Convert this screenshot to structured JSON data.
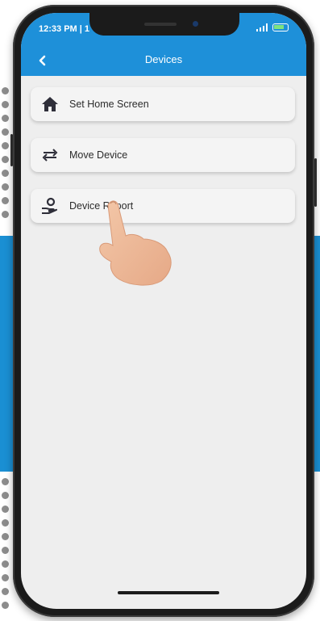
{
  "status_bar": {
    "time": "12:33 PM | 1"
  },
  "header": {
    "title": "Devices",
    "back_icon": "chevron-left-icon"
  },
  "menu": {
    "items": [
      {
        "label": "Set Home Screen",
        "icon": "home-icon"
      },
      {
        "label": "Move Device",
        "icon": "swap-arrows-icon"
      },
      {
        "label": "Device Report",
        "icon": "person-hand-icon"
      }
    ]
  },
  "colors": {
    "accent": "#1e90d9",
    "background": "#eeeeee",
    "card": "#f4f4f4"
  }
}
